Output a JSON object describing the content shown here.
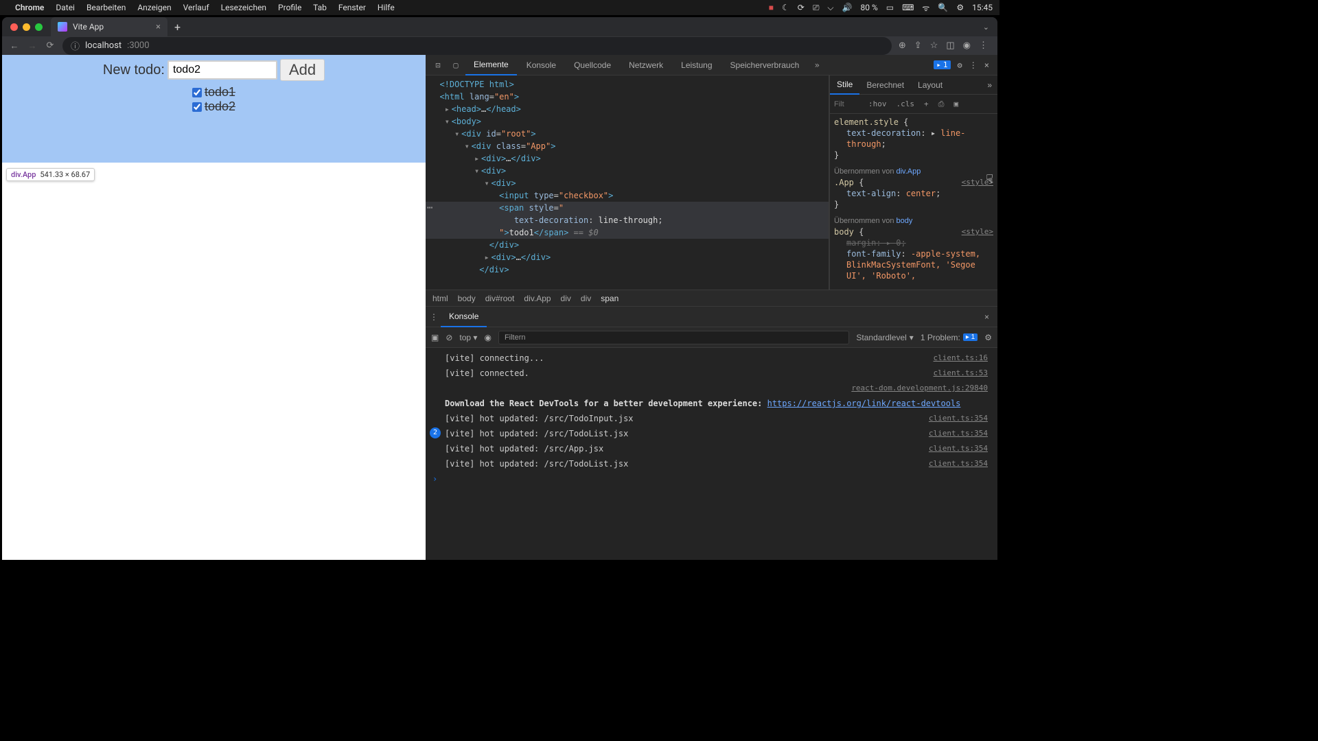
{
  "menubar": {
    "app": "Chrome",
    "items": [
      "Datei",
      "Bearbeiten",
      "Anzeigen",
      "Verlauf",
      "Lesezeichen",
      "Profile",
      "Tab",
      "Fenster",
      "Hilfe"
    ],
    "battery": "80 %",
    "time": "15:45"
  },
  "browser": {
    "tab_title": "Vite App",
    "url_host": "localhost",
    "url_port": ":3000"
  },
  "app": {
    "new_todo_label": "New todo:",
    "input_value": "todo2",
    "add_button": "Add",
    "todos": [
      {
        "text": "todo1",
        "done": true
      },
      {
        "text": "todo2",
        "done": true
      }
    ],
    "highlight_tooltip_selector": "div.App",
    "highlight_tooltip_size": "541.33 × 68.67"
  },
  "devtools": {
    "tabs": [
      "Elemente",
      "Konsole",
      "Quellcode",
      "Netzwerk",
      "Leistung",
      "Speicherverbrauch"
    ],
    "active_tab": "Elemente",
    "issues_count": "1",
    "styles_tabs": [
      "Stile",
      "Berechnet",
      "Layout"
    ],
    "active_styles_tab": "Stile",
    "styles_filter_placeholder": "Filt",
    "hov_btn": ":hov",
    "cls_btn": ".cls",
    "rule1_header": "element.style {",
    "rule1_prop": "text-decoration",
    "rule1_val": "line-through",
    "rule2_inherit": "Übernommen von ",
    "rule2_inherit_sel": "div.App",
    "rule2_sel": ".App {",
    "rule2_src": "<style>",
    "rule2_prop": "text-align",
    "rule2_val": "center",
    "rule3_inherit": "Übernommen von ",
    "rule3_inherit_sel": "body",
    "rule3_sel": "body {",
    "rule3_src": "<style>",
    "rule3_p1n": "margin",
    "rule3_p1v": "0",
    "rule3_p2n": "font-family",
    "rule3_p2v": "-apple-system, BlinkMacSystemFont, 'Segoe UI', 'Roboto',",
    "breadcrumb": [
      "html",
      "body",
      "div#root",
      "div.App",
      "div",
      "div",
      "span"
    ],
    "dom_doctype": "<!DOCTYPE html>",
    "dom_html_open": "<html lang=\"en\">",
    "dom_head": "<head>…</head>",
    "dom_body_open": "<body>",
    "dom_root": "<div id=\"root\">",
    "dom_app": "<div class=\"App\">",
    "dom_div1": "<div>…</div>",
    "dom_div2_open": "<div>",
    "dom_div3_open": "<div>",
    "dom_input": "<input type=\"checkbox\">",
    "dom_span_open": "<span style=\"",
    "dom_span_style": "text-decoration: line-through;",
    "dom_span_close_start": "\">",
    "dom_span_text": "todo1",
    "dom_span_close": "</span>",
    "dom_span_eq": " == $0",
    "dom_div3_close": "</div>",
    "dom_div4": "<div>…</div>",
    "dom_div2_close": "</div>",
    "console": {
      "tab": "Konsole",
      "top": "top",
      "filter_placeholder": "Filtern",
      "level": "Standardlevel",
      "problems_label": "1 Problem:",
      "problems_count": "1",
      "lines": [
        {
          "msg": "[vite] connecting...",
          "src": "client.ts:16"
        },
        {
          "msg": "[vite] connected.",
          "src": "client.ts:53"
        },
        {
          "msg": "",
          "src": "react-dom.development.js:29840",
          "right_only": true
        },
        {
          "bold": "Download the React DevTools for a better development experience: ",
          "link": "https://reactjs.org/link/react-devtools"
        },
        {
          "msg": "[vite] hot updated: /src/TodoInput.jsx",
          "src": "client.ts:354"
        },
        {
          "count": "2",
          "msg": "[vite] hot updated: /src/TodoList.jsx",
          "src": "client.ts:354"
        },
        {
          "msg": "[vite] hot updated: /src/App.jsx",
          "src": "client.ts:354"
        },
        {
          "msg": "[vite] hot updated: /src/TodoList.jsx",
          "src": "client.ts:354"
        }
      ]
    }
  }
}
